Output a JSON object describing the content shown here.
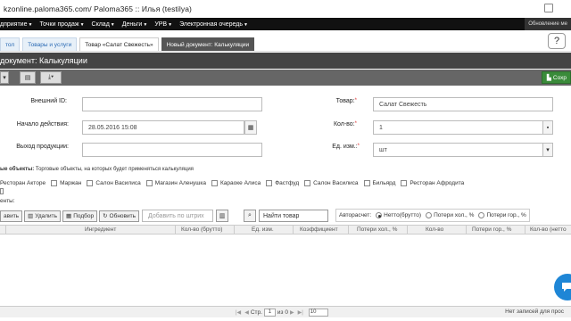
{
  "browser": {
    "url_text": "kzonline.paloma365.com/  Paloma365 :: Илья (testilya)"
  },
  "topnav": {
    "items": [
      "дприятие",
      "Точки продаж",
      "Склад",
      "Деньги",
      "УРВ",
      "Электронная очередь"
    ],
    "right_text": "Обновление ме"
  },
  "tabs": [
    "тол",
    "Товары и услуги",
    "Товар «Салат Свежесть»",
    "Новый документ: Калькуляции"
  ],
  "page_title": "документ: Калькуляции",
  "save_label": "Сохр",
  "form": {
    "external_id_label": "Внешний ID:",
    "external_id_value": "",
    "start_label": "Начало действия:",
    "start_value": "28.05.2016 15:08",
    "output_label": "Выход продукции:",
    "output_value": "",
    "product_label": "Товар:",
    "product_value": "Салат Свежесть",
    "qty_label": "Кол-во:",
    "qty_value": "1",
    "unit_label": "Ед. изм.:",
    "unit_value": "шт"
  },
  "objects": {
    "label": "ые объекты:",
    "hint": "Торговые объекты, на которых будет применяться калькуляция",
    "items": [
      "Ресторан Акторе",
      "Маржан",
      "Салон Василиса",
      "Магазин Аленушка",
      "Караоке Алиса",
      "Фастфуд",
      "Салон Василиса",
      "Бильярд",
      "Ресторан Афродита"
    ]
  },
  "components_label": "енты:",
  "panel_toolbar": {
    "add": "авить",
    "delete": "Удалить",
    "selection": "Подбор",
    "refresh": "Обновить",
    "add_by_barcode_placeholder": "Добавить по штрих",
    "find_product": "Найти товар",
    "autocalc_label": "Авторасчет:",
    "opt_net": "Нетто(брутто)",
    "opt_cold": "Потери хол., %",
    "opt_hot": "Потери гор., %"
  },
  "table_headers": [
    "Ингредиент",
    "Кол-во (брутто)",
    "Ед. изм.",
    "Коэффициент",
    "Потери хол., %",
    "Кол-во",
    "Потери гор., %",
    "Кол-во (нетто"
  ],
  "footer": {
    "page_label": "Стр.",
    "page_value": "1",
    "of_label": "из 0",
    "per_page": "10",
    "no_records": "Нет записей для прос"
  }
}
